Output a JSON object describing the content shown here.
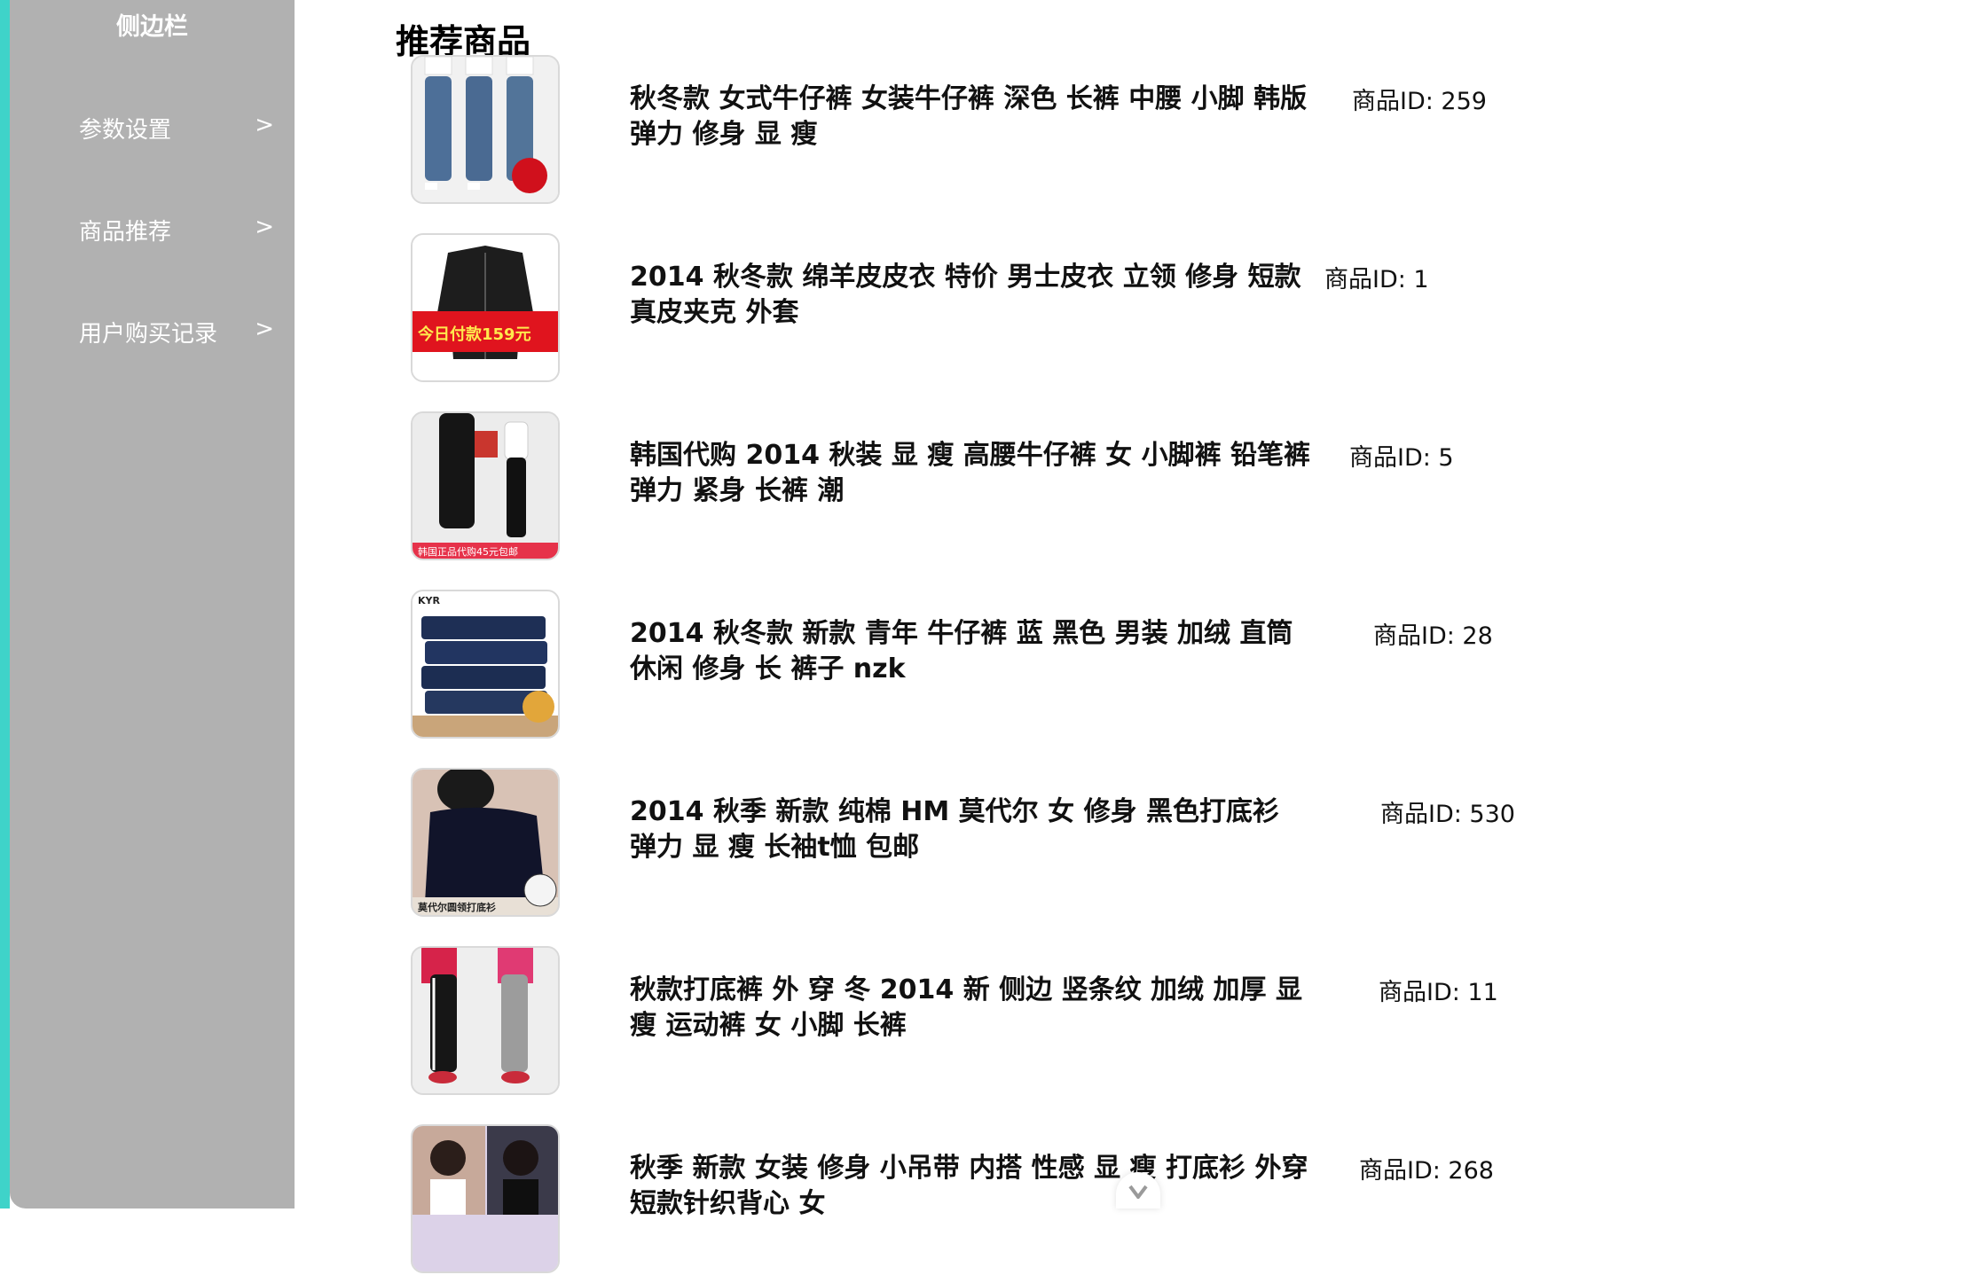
{
  "sidebar": {
    "title": "侧边栏",
    "items": [
      {
        "label": "参数设置",
        "arrow": ">"
      },
      {
        "label": "商品推荐",
        "arrow": ">"
      },
      {
        "label": "用户购买记录",
        "arrow": ">"
      }
    ]
  },
  "main": {
    "title": "推荐商品",
    "products": [
      {
        "name": "秋冬款 女式牛仔裤 女装牛仔裤 深色 长裤 中腰 小脚 韩版 弹力 修身 显 瘦",
        "id_text": "商品ID: 259",
        "image_icon": "jeans-models-photo"
      },
      {
        "name": "2014 秋冬款 绵羊皮皮衣 特价 男士皮衣 立领 修身 短款 真皮夹克 外套",
        "id_text": "商品ID: 1",
        "image_icon": "leather-jacket-photo",
        "badge_text": "今日付款159元"
      },
      {
        "name": "韩国代购 2014 秋装 显 瘦 高腰牛仔裤 女 小脚裤 铅笔裤 弹力 紧身 长裤 潮",
        "id_text": "商品ID: 5",
        "image_icon": "black-jeans-photo",
        "badge_text": "韩国正品代购45元包邮"
      },
      {
        "name": "2014 秋冬款 新款 青年 牛仔裤 蓝 黑色 男装 加绒 直筒 休闲 修身 长 裤子 nzk",
        "id_text": "商品ID: 28",
        "image_icon": "folded-jeans-photo"
      },
      {
        "name": "2014 秋季 新款 纯棉 HM 莫代尔 女 修身 黑色打底衫 弹力 显 瘦 长袖t恤 包邮",
        "id_text": "商品ID: 530",
        "image_icon": "black-top-photo",
        "badge_text": "莫代尔圆领打底衫"
      },
      {
        "name": "秋款打底裤 外 穿 冬 2014 新 侧边 竖条纹 加绒 加厚 显 瘦 运动裤 女 小脚 长裤",
        "id_text": "商品ID: 11",
        "image_icon": "leggings-photo"
      },
      {
        "name": "秋季 新款 女装 修身 小吊带 内搭 性感 显 瘦 打底衫 外穿 短款针织背心 女",
        "id_text": "商品ID: 268",
        "image_icon": "camisole-photo"
      }
    ]
  },
  "colors": {
    "sidebar_bg": "#b1b1b1",
    "accent": "#3fd3c9",
    "text": "#111111"
  }
}
